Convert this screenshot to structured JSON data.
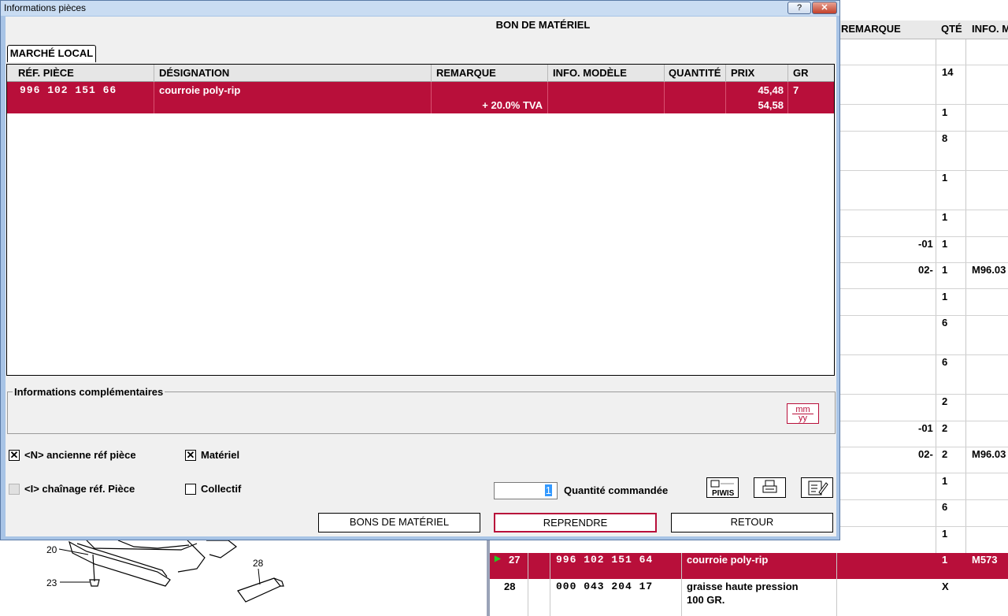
{
  "window": {
    "title": "Informations pièces",
    "help_label": "?",
    "close_label": "✕"
  },
  "dialog": {
    "heading": "BON DE MATÉRIEL",
    "tab_label": "MARCHÉ LOCAL",
    "grid": {
      "columns": [
        "RÉF. PIÈCE",
        "DÉSIGNATION",
        "REMARQUE",
        "INFO. MODÈLE",
        "QUANTITÉ",
        "PRIX",
        "GR"
      ],
      "row": {
        "ref": "996 102 151 66",
        "designation": "courroie poly-rip",
        "remarque": "+ 20.0% TVA",
        "info_modele": "",
        "quantite": "",
        "prix_ht": "45,48",
        "prix_ttc": "54,58",
        "gr": "7"
      }
    },
    "info_complementaires_label": "Informations complémentaires",
    "mmyy": {
      "top": "mm",
      "bottom": "yy"
    },
    "checkboxes": {
      "ancienne_ref": {
        "label": "<N> ancienne réf pièce",
        "checked": true
      },
      "materiel": {
        "label": "Matériel",
        "checked": true
      },
      "chainage": {
        "label": "<I> chaînage réf. Pièce",
        "checked": false,
        "disabled": true
      },
      "collectif": {
        "label": "Collectif",
        "checked": false
      }
    },
    "quantity": {
      "value": "1",
      "label": "Quantité commandée"
    },
    "icons": {
      "piwis": "PIWIS"
    },
    "buttons": {
      "bons": "BONS DE MATÉRIEL",
      "reprendre": "REPRENDRE",
      "retour": "RETOUR"
    }
  },
  "background": {
    "header": {
      "remarque": "REMARQUE",
      "qte": "QTÉ",
      "info": "INFO. M"
    },
    "rows": [
      {
        "qte": "14"
      },
      {
        "qte": "1"
      },
      {
        "qte": "8"
      },
      {
        "qte": "1"
      },
      {
        "qte": "1"
      },
      {
        "remarque": "-01",
        "qte": "1"
      },
      {
        "remarque": "02-",
        "qte": "1",
        "info": "M96.03"
      },
      {
        "qte": "1"
      },
      {
        "qte": "6"
      },
      {
        "qte": "6"
      },
      {
        "qte": "2"
      },
      {
        "remarque": "-01",
        "qte": "2"
      },
      {
        "remarque": "02-",
        "qte": "2",
        "info": "M96.03"
      },
      {
        "qte": "1"
      },
      {
        "qte": "6"
      },
      {
        "qte": "1"
      }
    ],
    "selected_row": {
      "pos": "27",
      "ref": "996 102 151 64",
      "designation": "courroie poly-rip",
      "qte": "1",
      "info": "M573"
    },
    "last_row": {
      "pos": "28",
      "ref": "000 043 204 17",
      "designation_line1": "graisse haute pression",
      "designation_line2": "100 GR.",
      "qte": "X"
    },
    "illustration_labels": {
      "a": "20",
      "b": "23",
      "c": "28"
    }
  },
  "colors": {
    "accent": "#b80f3a",
    "frame": "#a8c4e6"
  }
}
